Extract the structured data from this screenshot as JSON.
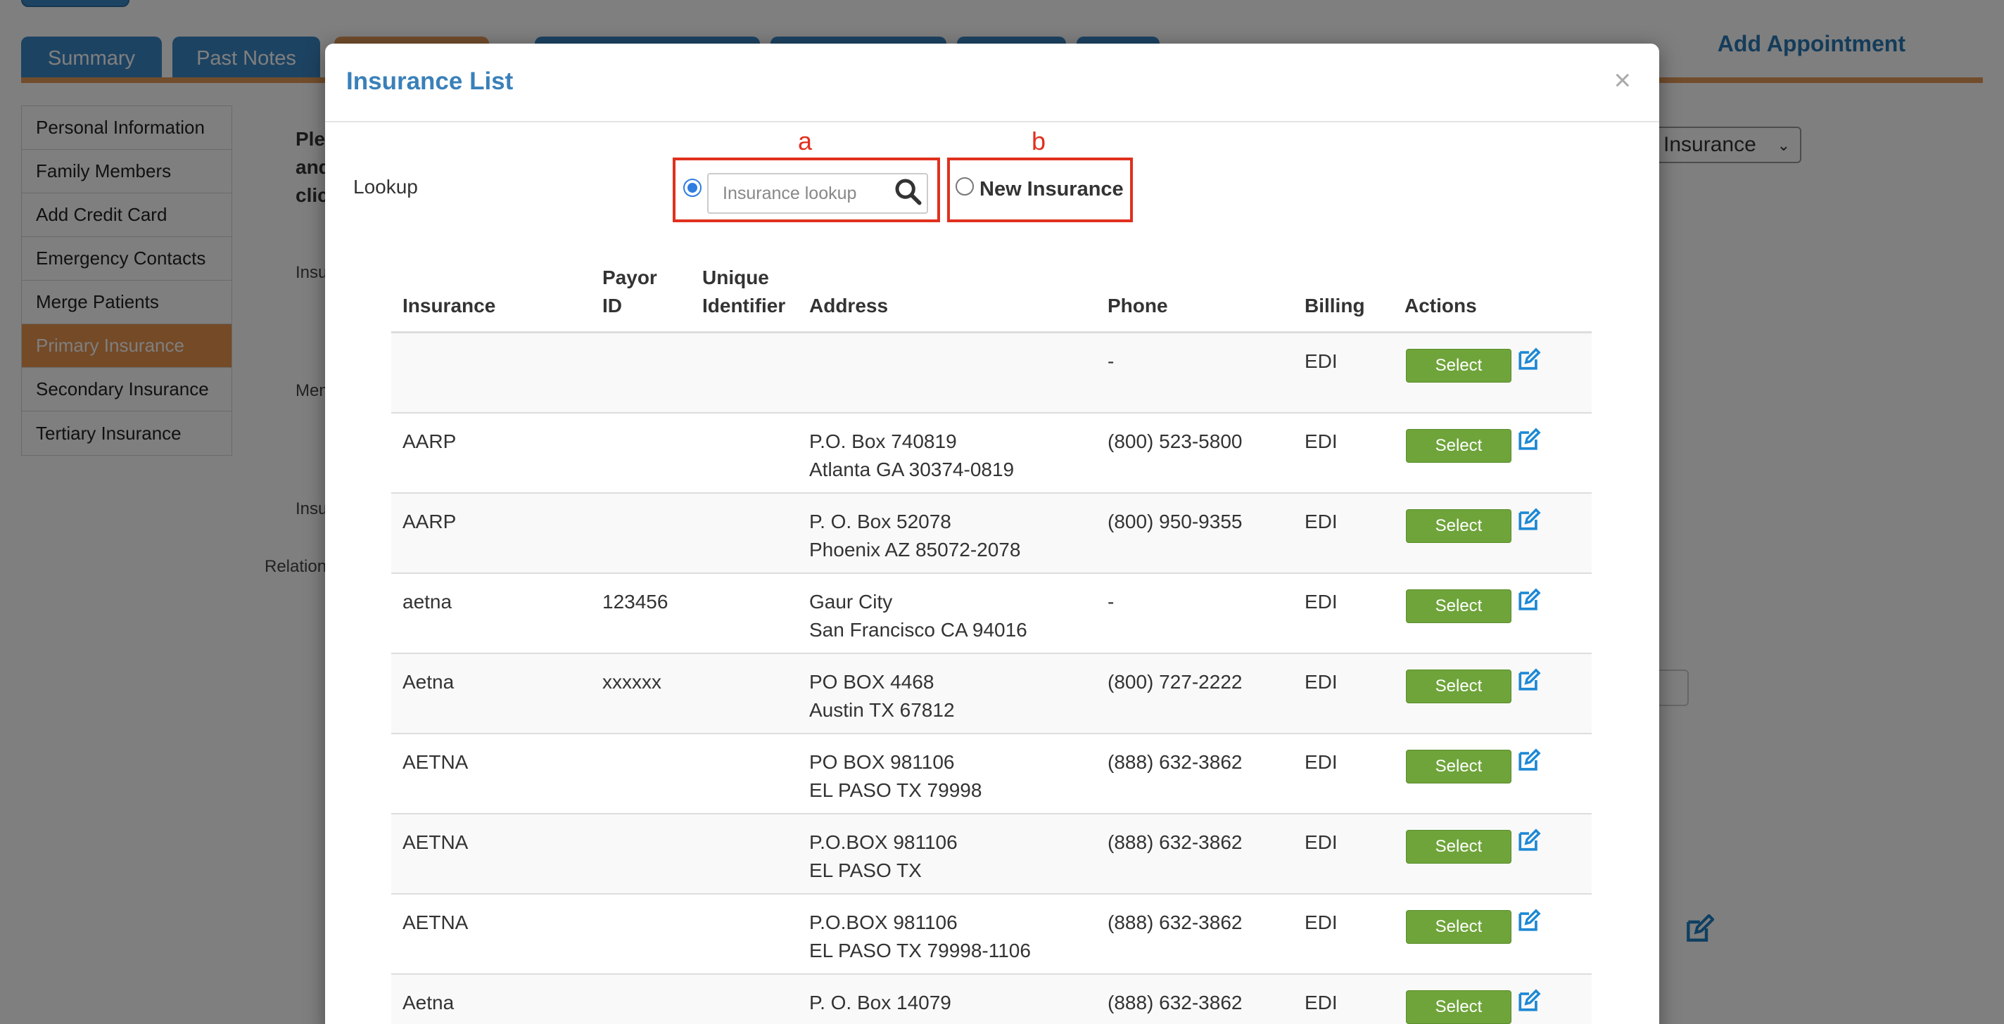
{
  "background": {
    "tabs": [
      {
        "label": "Summary"
      },
      {
        "label": "Past Notes"
      },
      {
        "label": ""
      },
      {
        "label": ""
      },
      {
        "label": ""
      },
      {
        "label": ""
      },
      {
        "label": ""
      }
    ],
    "add_appointment": "Add Appointment",
    "sidebar": {
      "items": [
        {
          "label": "Personal Information"
        },
        {
          "label": "Family Members"
        },
        {
          "label": "Add Credit Card"
        },
        {
          "label": "Emergency Contacts"
        },
        {
          "label": "Merge Patients"
        },
        {
          "label": "Primary Insurance"
        },
        {
          "label": "Secondary Insurance"
        },
        {
          "label": "Tertiary Insurance"
        }
      ]
    },
    "snippets": {
      "line1": "Ple",
      "line2": "and",
      "line3": "clic",
      "insu1": "Insu",
      "mem": "Mem",
      "insu2": "Insu",
      "relation": "Relation"
    },
    "insurance_select_value": "Insurance"
  },
  "modal": {
    "title": "Insurance List",
    "close": "×",
    "lookup_label": "Lookup",
    "annotation_a": "a",
    "annotation_b": "b",
    "lookup_placeholder": "Insurance lookup",
    "new_insurance_label": "New Insurance",
    "columns": {
      "insurance": "Insurance",
      "payor_1": "Payor",
      "payor_2": "ID",
      "unique_1": "Unique",
      "unique_2": "Identifier",
      "address": "Address",
      "phone": "Phone",
      "billing": "Billing",
      "actions": "Actions"
    },
    "select_label": "Select",
    "rows": [
      {
        "insurance": "",
        "payor_id": "",
        "unique_id": "",
        "address1": "",
        "address2": "",
        "phone": "-",
        "billing": "EDI"
      },
      {
        "insurance": "AARP",
        "payor_id": "",
        "unique_id": "",
        "address1": "P.O. Box 740819",
        "address2": "Atlanta GA 30374-0819",
        "phone": "(800) 523-5800",
        "billing": "EDI"
      },
      {
        "insurance": "AARP",
        "payor_id": "",
        "unique_id": "",
        "address1": "P. O. Box 52078",
        "address2": "Phoenix AZ 85072-2078",
        "phone": "(800) 950-9355",
        "billing": "EDI"
      },
      {
        "insurance": "aetna",
        "payor_id": "123456",
        "unique_id": "",
        "address1": "Gaur City",
        "address2": "San Francisco CA 94016",
        "phone": "-",
        "billing": "EDI"
      },
      {
        "insurance": "Aetna",
        "payor_id": "xxxxxx",
        "unique_id": "",
        "address1": "PO BOX 4468",
        "address2": "Austin TX 67812",
        "phone": "(800) 727-2222",
        "billing": "EDI"
      },
      {
        "insurance": "AETNA",
        "payor_id": "",
        "unique_id": "",
        "address1": "PO BOX 981106",
        "address2": "EL PASO TX 79998",
        "phone": "(888) 632-3862",
        "billing": "EDI"
      },
      {
        "insurance": "AETNA",
        "payor_id": "",
        "unique_id": "",
        "address1": "P.O.BOX 981106",
        "address2": "EL PASO TX",
        "phone": "(888) 632-3862",
        "billing": "EDI"
      },
      {
        "insurance": "AETNA",
        "payor_id": "",
        "unique_id": "",
        "address1": "P.O.BOX 981106",
        "address2": "EL PASO TX 79998-1106",
        "phone": "(888) 632-3862",
        "billing": "EDI"
      },
      {
        "insurance": "Aetna",
        "payor_id": "",
        "unique_id": "",
        "address1": "P. O. Box 14079",
        "address2": "",
        "phone": "(888) 632-3862",
        "billing": "EDI"
      }
    ]
  }
}
